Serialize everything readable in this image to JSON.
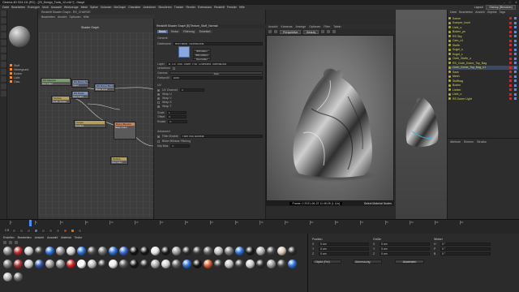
{
  "app": {
    "title": "Cinema 4D S24.111 (RC) - [29_Design_Tools_12.c4d *] - Haupt",
    "window_controls": [
      "–",
      "□",
      "✕"
    ]
  },
  "menubar": {
    "items": [
      "Datei",
      "Bearbeiten",
      "Erzeugen",
      "Modi",
      "Auswahl",
      "Werkzeuge",
      "Mesh",
      "Spline",
      "Volumen",
      "MoGraph",
      "Charakter",
      "Animieren",
      "Simulieren",
      "Tracker",
      "Render",
      "Extensions",
      "Redshift",
      "Fenster",
      "Hilfe"
    ],
    "layout_label": "Layout:",
    "layout_value": "Startup (Benutzer)"
  },
  "node_editor": {
    "title": "Redshift Shader Graph - RS_CHARGE",
    "tabs": [
      "Bearbeiten",
      "Ansicht",
      "Optionen",
      "Hilfe"
    ],
    "graph_label": "Shader Graph",
    "left_materials": [
      "Stoff",
      "Hintergrund",
      "Boden",
      "Licht",
      "Glas"
    ],
    "nodes": [
      {
        "header": "RS Material",
        "line": "Out Color",
        "color": "green"
      },
      {
        "header": "RS Bump Map",
        "line": "Input",
        "color": "blue"
      },
      {
        "header": "RS Bump Blender",
        "line": "Base Input",
        "color": "blue"
      },
      {
        "header": "Texture",
        "line": "Color Output",
        "color": "gold"
      },
      {
        "header": "RS Noise",
        "line": "Out Color",
        "color": "blue"
      },
      {
        "header": "Output",
        "line": "Surface",
        "color": "gold"
      },
      {
        "header": "Bump Blender",
        "line": "Base Color",
        "color": "orange"
      },
      {
        "header": "Texture",
        "line": "Out Color",
        "color": "gold"
      }
    ]
  },
  "attributes": {
    "header": "Redshift Shader Graph [5] Texture_Stoff_Normal",
    "tabs": [
      "Basis",
      "Textur",
      "Filterung",
      "Erweitert"
    ],
    "section_general": "General",
    "filename_label": "Dateiname",
    "filename_value": "tex/Fabric_Normal.png",
    "flip_label": "Umkehren",
    "image_buttons": [
      "Bild laden",
      "Bild wählen",
      "Neu laden"
    ],
    "layer_label": "Layer",
    "layer_value": "B_CE_Ess_Silver_Foil_Crumpled_Normal.jpg",
    "gamma_label": "Gamma",
    "gamma_button": "Auto",
    "color_space_label": "Farbprofil",
    "color_space_value": "Auto",
    "uv_section": "UV",
    "uv_rows": [
      {
        "label": "UV Channel",
        "value": "0"
      },
      {
        "label": "Wrap U",
        "value": ""
      },
      {
        "label": "Wrap V",
        "value": ""
      },
      {
        "label": "Wrap S",
        "value": ""
      },
      {
        "label": "Wrap T",
        "value": ""
      }
    ],
    "scale_label": "Scale",
    "scale_value": "1",
    "offset_label": "Offset",
    "offset_value": "0",
    "rotate_label": "Rotate",
    "rotate_value": "0",
    "advanced_section": "Advanced",
    "filter_label": "Filter Enable",
    "filter_value": "Filter mip Bilinear",
    "mip_label": "Mip Bias",
    "mip_value": "0",
    "preview_label": "Bilder Bilinear Filtering"
  },
  "viewport": {
    "menu": [
      "Ansicht",
      "Kameras",
      "Anzeige",
      "Optionen",
      "Filter",
      "Tafeln"
    ],
    "camera_value": "Perspektive",
    "render_mode": "Beauty",
    "status_left": "",
    "status_center": "Frame: 0  2021-06-22  11:46:26  (1.11s)",
    "status_right": "Select Material Nodes"
  },
  "object_manager": {
    "tabs": [
      "Datei",
      "Bearbeiten",
      "Ansicht",
      "Objekte",
      "Tags"
    ],
    "objects": [
      {
        "name": "Szene",
        "selected": false
      },
      {
        "name": "Koerper_hoch",
        "selected": false
      },
      {
        "name": "Licht_o",
        "selected": false
      },
      {
        "name": "Boden_ps",
        "selected": false
      },
      {
        "name": "RS Sky",
        "selected": false
      },
      {
        "name": "Cam_o1",
        "selected": false
      },
      {
        "name": "Stoffe",
        "selected": false
      },
      {
        "name": "Kugel_o",
        "selected": false
      },
      {
        "name": "Kugel_c",
        "selected": false
      },
      {
        "name": "Cloth_Stoffe_o",
        "selected": false
      },
      {
        "name": "RS_Cloth_Dome_Top_Bag",
        "selected": false
      },
      {
        "name": "Cloth_Dome_Top_Bag_o1",
        "selected": true
      },
      {
        "name": "Sack",
        "selected": false
      },
      {
        "name": "Mesh",
        "selected": false
      },
      {
        "name": "Stoffbag",
        "selected": false
      },
      {
        "name": "Boden",
        "selected": false
      },
      {
        "name": "Lichter",
        "selected": false
      },
      {
        "name": "Licht_o",
        "selected": false
      },
      {
        "name": "RS Dome Light",
        "selected": false
      }
    ]
  },
  "attr2": {
    "tabs": [
      "Attribute",
      "Ebenen",
      "Struktur"
    ]
  },
  "timeline": {
    "ticks": [
      "0",
      "5",
      "10",
      "15",
      "20",
      "25",
      "30",
      "35",
      "40",
      "45",
      "50",
      "55",
      "60",
      "65",
      "70",
      "75",
      "80",
      "85",
      "90"
    ],
    "current_frame": "0 B"
  },
  "material_manager": {
    "menu": [
      "Erstellen",
      "Bearbeiten",
      "Ansicht",
      "Auswahl",
      "Material",
      "Textur"
    ],
    "swatches": [
      "#8a8a8a",
      "#b82b2b",
      "#c8c8c8",
      "#3a3a3a",
      "#2b6fd8",
      "#8e8e8e",
      "#d0d0d0",
      "#2b6fd8",
      "#4a4a4a",
      "#6a6a6a",
      "#2b6fd8",
      "#3366cc",
      "#111111",
      "#151515",
      "#e3e3e3",
      "#1a1a1a",
      "#9b9b9b",
      "#2a2a2a",
      "#3c3c3c",
      "#5a5a5a",
      "#bbbbbb",
      "#7a7a7a",
      "#2b6fd8",
      "#1a1a1a",
      "#b0b0b0",
      "#444444",
      "#d8c8b0",
      "#2a2a2a",
      "#777777",
      "#aa3333",
      "#cccccc",
      "#3355aa",
      "#999999",
      "#8a8a8a",
      "#cc2222",
      "#ffffff",
      "#bbbbbb",
      "#333333",
      "#eaeaea",
      "#555555",
      "#161616",
      "#2a2a2a",
      "#aaaaaa",
      "#d0d0d0",
      "#5c5c5c",
      "#2b6fd8",
      "#101010",
      "#d65b2b",
      "#3a3a3a",
      "#bfbfbf",
      "#404040",
      "#cccccc",
      "#2d2d2d",
      "#999999",
      "#444444",
      "#2b6fd8",
      "#b4b4b4",
      "#6e6e6e"
    ]
  },
  "coordinates": {
    "headers": [
      "Position",
      "Größe",
      "Winkel"
    ],
    "position": [
      {
        "axis": "X",
        "value": "0 cm"
      },
      {
        "axis": "Y",
        "value": "0 cm"
      },
      {
        "axis": "Z",
        "value": "0 cm"
      }
    ],
    "size": [
      {
        "axis": "X",
        "value": "0 cm"
      },
      {
        "axis": "Y",
        "value": "0 cm"
      },
      {
        "axis": "Z",
        "value": "0 cm"
      }
    ],
    "rotation": [
      {
        "axis": "H",
        "value": "0 °"
      },
      {
        "axis": "P",
        "value": "0 °"
      },
      {
        "axis": "B",
        "value": "0 °"
      }
    ],
    "object_mode": "Objekt (Rel)",
    "size_mode": "Abmessung",
    "apply_label": "Anwenden"
  }
}
